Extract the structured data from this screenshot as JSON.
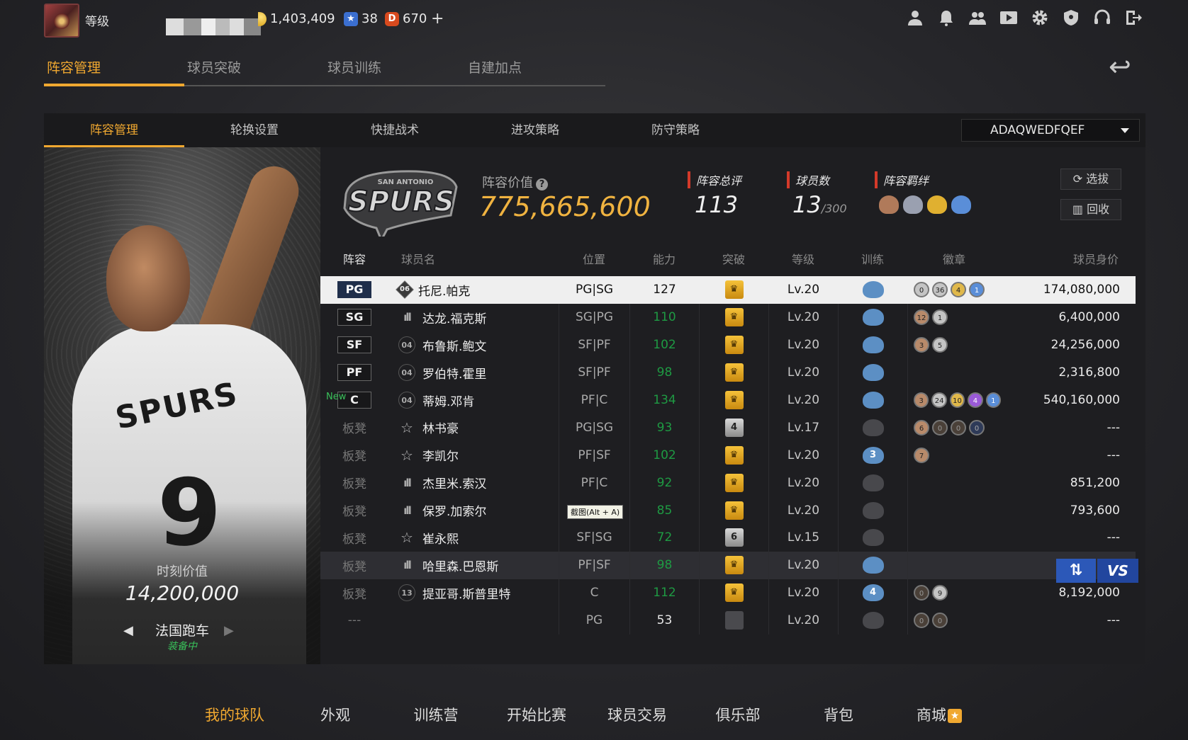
{
  "header": {
    "level_label": "等级",
    "currencies": [
      {
        "name": "gold",
        "value": "1,403,409"
      },
      {
        "name": "star",
        "icon": "★",
        "value": "38"
      },
      {
        "name": "d-coin",
        "icon": "D",
        "value": "670"
      }
    ],
    "add_label": "+"
  },
  "top_icons": [
    "person-icon",
    "bell-icon",
    "friends-icon",
    "video-icon",
    "gear-icon",
    "shield-icon",
    "headset-icon",
    "exit-icon"
  ],
  "main_tabs": [
    "阵容管理",
    "球员突破",
    "球员训练",
    "自建加点"
  ],
  "sub_tabs": [
    "阵容管理",
    "轮换设置",
    "快捷战术",
    "进攻策略",
    "防守策略"
  ],
  "lineup_select": "ADAQWEDFQEF",
  "card": {
    "moment_label": "时刻价值",
    "moment_value": "14,200,000",
    "name": "法国跑车",
    "status": "装备中",
    "jersey_number": "9",
    "jersey_team": "SPURS"
  },
  "team": {
    "value_label": "阵容价值",
    "help": "?",
    "value": "775,665,600",
    "rating_label": "阵容总评",
    "rating": "113",
    "count_label": "球员数",
    "count": "13",
    "count_max": "/300",
    "bond_label": "阵容羁绊",
    "draft_label": "选拔",
    "recycle_label": "回收",
    "logo_text": "SPURS",
    "logo_sub": "SAN ANTONIO"
  },
  "table": {
    "headers": [
      "阵容",
      "球员名",
      "位置",
      "能力",
      "突破",
      "等级",
      "训练",
      "徽章",
      "球员身价"
    ],
    "rows": [
      {
        "slot": "PG",
        "bench": false,
        "tier": "06",
        "tier_style": "diamond",
        "name": "托尼.帕克",
        "pos": "PG|SG",
        "ability": "127",
        "ability_white": true,
        "breakthrough": "crown",
        "level": "Lv.20",
        "train": "",
        "train_empty": false,
        "badges": [
          [
            "0",
            "silver"
          ],
          [
            "36",
            "silver"
          ],
          [
            "4",
            "gold"
          ],
          [
            "1",
            "blue"
          ]
        ],
        "value": "174,080,000",
        "selected": true
      },
      {
        "slot": "SG",
        "bench": false,
        "tier": "ıll",
        "tier_style": "bars",
        "name": "达龙.福克斯",
        "pos": "SG|PG",
        "ability": "110",
        "breakthrough": "crown",
        "level": "Lv.20",
        "train": "",
        "train_empty": false,
        "badges": [
          [
            "12",
            "bronze"
          ],
          [
            "1",
            "silver"
          ]
        ],
        "value": "6,400,000"
      },
      {
        "slot": "SF",
        "bench": false,
        "tier": "04",
        "tier_style": "num",
        "name": "布鲁斯.鲍文",
        "pos": "SF|PF",
        "ability": "102",
        "breakthrough": "crown",
        "level": "Lv.20",
        "train": "",
        "train_empty": false,
        "badges": [
          [
            "3",
            "bronze"
          ],
          [
            "5",
            "silver"
          ]
        ],
        "value": "24,256,000"
      },
      {
        "slot": "PF",
        "bench": false,
        "tier": "04",
        "tier_style": "num",
        "name": "罗伯特.霍里",
        "pos": "SF|PF",
        "ability": "98",
        "breakthrough": "crown",
        "level": "Lv.20",
        "train": "",
        "train_empty": false,
        "badges": [],
        "value": "2,316,800"
      },
      {
        "slot": "C",
        "bench": false,
        "new": "New",
        "tier": "04",
        "tier_style": "num",
        "name": "蒂姆.邓肯",
        "pos": "PF|C",
        "ability": "134",
        "breakthrough": "crown",
        "level": "Lv.20",
        "train": "",
        "train_empty": false,
        "badges": [
          [
            "3",
            "bronze"
          ],
          [
            "24",
            "silver"
          ],
          [
            "10",
            "gold"
          ],
          [
            "4",
            "purple"
          ],
          [
            "1",
            "blue"
          ]
        ],
        "value": "540,160,000"
      },
      {
        "slot": "板凳",
        "bench": true,
        "tier": "☆",
        "tier_style": "star",
        "name": "林书豪",
        "pos": "PG|SG",
        "ability": "93",
        "breakthrough": "4",
        "level": "Lv.17",
        "train": "",
        "train_empty": true,
        "badges": [
          [
            "6",
            "bronze"
          ],
          [
            "0",
            "dark"
          ],
          [
            "0",
            "dark"
          ],
          [
            "0",
            "navy"
          ]
        ],
        "value": "---"
      },
      {
        "slot": "板凳",
        "bench": true,
        "tier": "☆",
        "tier_style": "star",
        "name": "李凯尔",
        "pos": "PF|SF",
        "ability": "102",
        "breakthrough": "crown",
        "level": "Lv.20",
        "train": "3",
        "train_empty": false,
        "badges": [
          [
            "7",
            "bronze"
          ]
        ],
        "value": "---"
      },
      {
        "slot": "板凳",
        "bench": true,
        "tier": "ıll",
        "tier_style": "bars",
        "name": "杰里米.索汉",
        "pos": "PF|C",
        "ability": "92",
        "breakthrough": "crown",
        "level": "Lv.20",
        "train": "",
        "train_empty": true,
        "badges": [],
        "value": "851,200"
      },
      {
        "slot": "板凳",
        "bench": true,
        "tier": "ıll",
        "tier_style": "bars",
        "name": "保罗.加索尔",
        "pos": "",
        "ability": "85",
        "breakthrough": "crown",
        "level": "Lv.20",
        "train": "",
        "train_empty": true,
        "badges": [],
        "value": "793,600"
      },
      {
        "slot": "板凳",
        "bench": true,
        "tier": "☆",
        "tier_style": "star",
        "name": "崔永熙",
        "pos": "SF|SG",
        "ability": "72",
        "breakthrough": "6",
        "level": "Lv.15",
        "train": "",
        "train_empty": true,
        "badges": [],
        "value": "---"
      },
      {
        "slot": "板凳",
        "bench": true,
        "tier": "ıll",
        "tier_style": "bars",
        "name": "哈里森.巴恩斯",
        "pos": "PF|SF",
        "ability": "98",
        "breakthrough": "crown",
        "level": "Lv.20",
        "train": "",
        "train_empty": false,
        "badges": [],
        "value": "",
        "hover": true
      },
      {
        "slot": "板凳",
        "bench": true,
        "tier": "13",
        "tier_style": "num",
        "name": "提亚哥.斯普里特",
        "pos": "C",
        "ability": "112",
        "breakthrough": "crown",
        "level": "Lv.20",
        "train": "4",
        "train_empty": false,
        "badges": [
          [
            "0",
            "dark"
          ],
          [
            "9",
            "silver"
          ]
        ],
        "value": "8,192,000"
      },
      {
        "slot": "---",
        "bench": true,
        "tier": "",
        "tier_style": "none",
        "name": "",
        "pos": "PG",
        "ability": "53",
        "ability_white": true,
        "breakthrough": "empty",
        "level": "Lv.20",
        "train": "",
        "train_empty": true,
        "badges": [
          [
            "0",
            "dark"
          ],
          [
            "0",
            "dark"
          ]
        ],
        "value": "---"
      }
    ]
  },
  "tooltip": "截图(Alt + A)",
  "vs_label": "VS",
  "swap_label": "⇅",
  "back_label": "↩",
  "bottom_nav": [
    "我的球队",
    "外观",
    "训练营",
    "开始比赛",
    "球员交易",
    "俱乐部",
    "背包",
    "商城"
  ],
  "colors": {
    "accent": "#f0a830",
    "ability_green": "#1e9a43",
    "stat_red": "#d43a2a",
    "value_gold": "#f0b340",
    "vs_blue": "#22469e"
  }
}
